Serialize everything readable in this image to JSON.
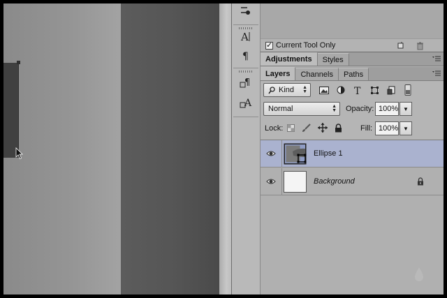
{
  "options": {
    "current_tool_only_label": "Current Tool Only",
    "current_tool_only_checked": true
  },
  "top_tabs": [
    {
      "label": "Adjustments",
      "active": true
    },
    {
      "label": "Styles",
      "active": false
    }
  ],
  "layer_tabs": [
    {
      "label": "Layers",
      "active": true
    },
    {
      "label": "Channels",
      "active": false
    },
    {
      "label": "Paths",
      "active": false
    }
  ],
  "filter": {
    "kind_label": "Kind",
    "icons": [
      "image-filter-icon",
      "adjustment-filter-icon",
      "type-filter-icon",
      "shape-filter-icon",
      "smart-object-filter-icon",
      "filter-toggle-icon"
    ]
  },
  "blend": {
    "mode": "Normal",
    "opacity_label": "Opacity:",
    "opacity_value": "100%"
  },
  "lock": {
    "label": "Lock:",
    "fill_label": "Fill:",
    "fill_value": "100%"
  },
  "layers": [
    {
      "name": "Ellipse 1",
      "selected": true,
      "italic": false,
      "locked": false,
      "visible": true
    },
    {
      "name": "Background",
      "selected": false,
      "italic": true,
      "locked": true,
      "visible": true
    }
  ],
  "tools": [
    "pen-tool-icon",
    "character-panel-icon",
    "paragraph-panel-icon",
    "paragraph-styles-icon",
    "character-styles-icon"
  ],
  "colors": {
    "selected_layer": "#aab2cf",
    "panel_bg": "#b4b4b4",
    "dark_column": "#555555"
  }
}
